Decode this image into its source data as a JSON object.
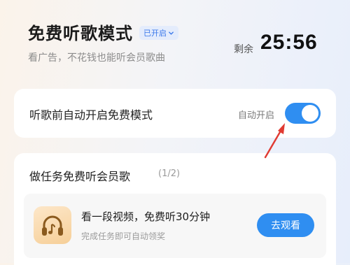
{
  "header": {
    "title": "免费听歌模式",
    "mode_badge": "已开启",
    "subtitle": "看广告，不花钱也能听会员歌曲",
    "remain_label": "剩余",
    "remain_time": "25:56"
  },
  "auto_mode": {
    "label": "听歌前自动开启免费模式",
    "status": "自动开启",
    "toggle_on": true
  },
  "tasks": {
    "title": "做任务免费听会员歌",
    "progress": "(1/2)",
    "items": [
      {
        "title": "看一段视频，免费听30分钟",
        "desc": "完成任务即可自动领奖",
        "button": "去观看",
        "icon": "headphone-music-icon"
      }
    ]
  },
  "colors": {
    "accent": "#2f8ef1",
    "arrow": "#e03a32"
  }
}
